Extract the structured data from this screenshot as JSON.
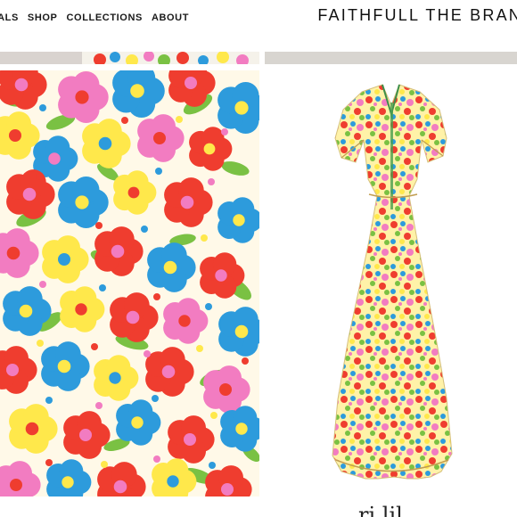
{
  "header": {
    "nav": [
      {
        "label": "VALS"
      },
      {
        "label": "SHOP"
      },
      {
        "label": "COLLECTIONS"
      },
      {
        "label": "ABOUT"
      }
    ],
    "brand": "FAITHFULL THE BRAN"
  },
  "palette": {
    "red": "#ef3d2f",
    "pink": "#f27cc1",
    "blue": "#2d9bdc",
    "yellow": "#ffe84b",
    "green": "#7ac143",
    "cream": "#fff9e8"
  },
  "footer": {
    "partial_title": "ri lil"
  }
}
